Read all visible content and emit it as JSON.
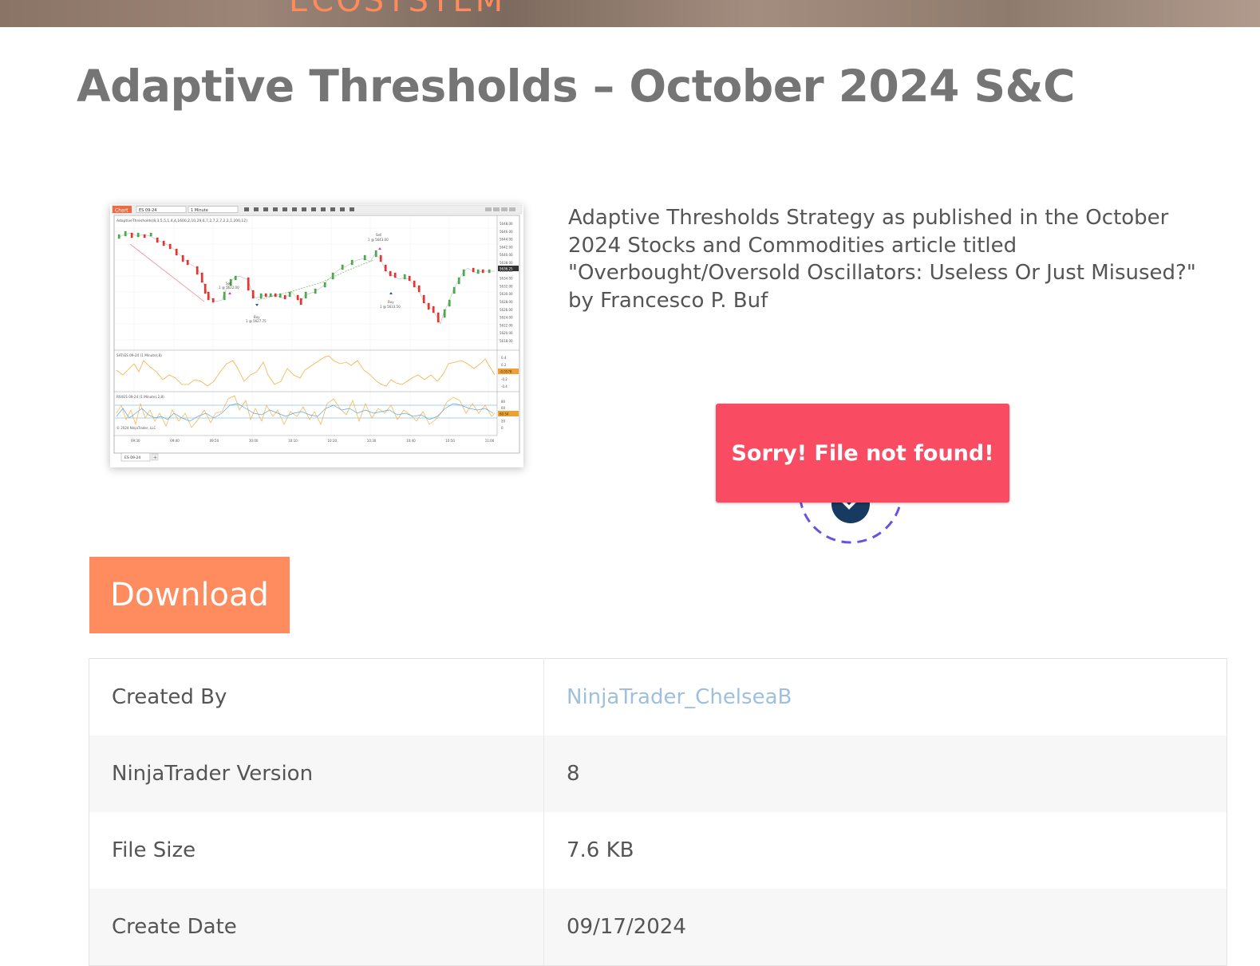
{
  "header": {
    "brand_text": "ECOSYSTEM"
  },
  "page": {
    "title": "Adaptive Thresholds – October 2024 S&C"
  },
  "thumbnail": {
    "tab_label": "Chart",
    "instrument": "ES 09-24",
    "interval": "1 Minute",
    "price_panel_label": "AdaptiveThresholds(8,3,5,5,1,4,4,1600,2,10,29,6,7,2,7,2,7,2,2,1,200,12)",
    "sat_panel_label": "SAT(ES 09-24 (1 Minute),8)",
    "rsi_panel_label": "RSI(ES 09-24 (1 Minute),2,8)",
    "copyright": "© 2024 NinjaTrader, LLC",
    "bottom_tab": "ES 09-24",
    "sell_label_1": "Sell",
    "sell_value_1": "1 @ 5622.00",
    "buy_label_1": "Buy",
    "buy_value_1": "1 @ 5627.75",
    "sell_label_2": "Sell",
    "sell_value_2": "1 @ 5643.00",
    "buy_label_2": "Buy",
    "buy_value_2": "1 @ 5633.50",
    "price_ticks": [
      "5648.00",
      "5646.00",
      "5644.00",
      "5642.00",
      "5640.00",
      "5638.00",
      "5636.00",
      "5634.00",
      "5632.00",
      "5630.00",
      "5628.00",
      "5626.00",
      "5624.00",
      "5622.00",
      "5620.00",
      "5618.00"
    ],
    "current_price": "5636.25",
    "sat_ticks": [
      "0.4",
      "0.2",
      "0",
      "-0.2",
      "-0.4"
    ],
    "sat_value": "-0.0578",
    "rsi_ticks": [
      "80",
      "60",
      "40",
      "20",
      "0"
    ],
    "rsi_value": "60.54",
    "time_ticks": [
      "09:30",
      "09:40",
      "09:50",
      "10:00",
      "10:10",
      "10:20",
      "10:30",
      "10:40",
      "10:50",
      "11:00"
    ]
  },
  "description": "Adaptive Thresholds Strategy as published in the October 2024 Stocks and Commodities article titled \"Overbought/Oversold Oscillators: Useless Or Just Misused?\" by Francesco P. Buf",
  "toast": {
    "message": "Sorry! File not found!",
    "color": "#f94c62"
  },
  "download": {
    "label": "Download",
    "color": "#ff8c5e"
  },
  "details": {
    "created_by_label": "Created By",
    "created_by_value": "NinjaTrader_ChelseaB",
    "version_label": "NinjaTrader Version",
    "version_value": "8",
    "size_label": "File Size",
    "size_value": "7.6 KB",
    "date_label": "Create Date",
    "date_value": "09/17/2024"
  }
}
